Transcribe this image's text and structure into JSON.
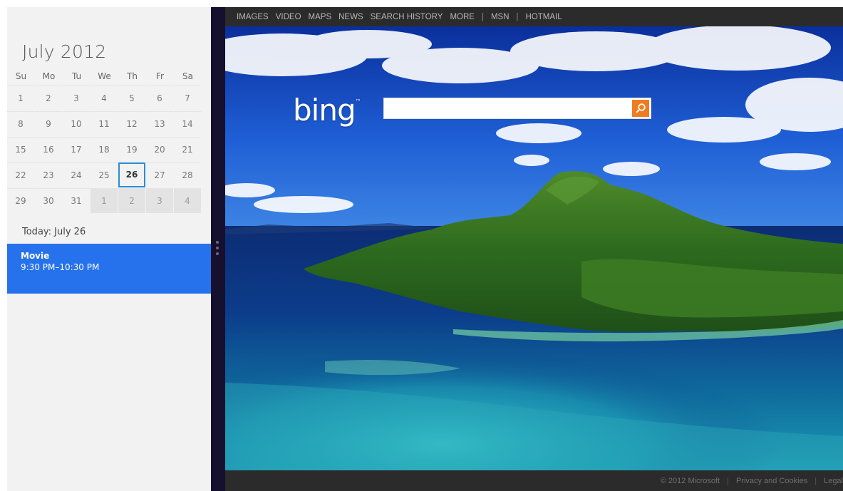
{
  "calendar": {
    "month_title": "July 2012",
    "weekdays": [
      "Su",
      "Mo",
      "Tu",
      "We",
      "Th",
      "Fr",
      "Sa"
    ],
    "weeks": [
      [
        {
          "d": "1",
          "other": false
        },
        {
          "d": "2",
          "other": false
        },
        {
          "d": "3",
          "other": false
        },
        {
          "d": "4",
          "other": false
        },
        {
          "d": "5",
          "other": false
        },
        {
          "d": "6",
          "other": false
        },
        {
          "d": "7",
          "other": false
        }
      ],
      [
        {
          "d": "8",
          "other": false
        },
        {
          "d": "9",
          "other": false
        },
        {
          "d": "10",
          "other": false
        },
        {
          "d": "11",
          "other": false
        },
        {
          "d": "12",
          "other": false
        },
        {
          "d": "13",
          "other": false
        },
        {
          "d": "14",
          "other": false
        }
      ],
      [
        {
          "d": "15",
          "other": false
        },
        {
          "d": "16",
          "other": false
        },
        {
          "d": "17",
          "other": false
        },
        {
          "d": "18",
          "other": false
        },
        {
          "d": "19",
          "other": false
        },
        {
          "d": "20",
          "other": false
        },
        {
          "d": "21",
          "other": false
        }
      ],
      [
        {
          "d": "22",
          "other": false
        },
        {
          "d": "23",
          "other": false
        },
        {
          "d": "24",
          "other": false
        },
        {
          "d": "25",
          "other": false
        },
        {
          "d": "26",
          "other": false,
          "today": true
        },
        {
          "d": "27",
          "other": false
        },
        {
          "d": "28",
          "other": false
        }
      ],
      [
        {
          "d": "29",
          "other": false
        },
        {
          "d": "30",
          "other": false
        },
        {
          "d": "31",
          "other": false
        },
        {
          "d": "1",
          "other": true
        },
        {
          "d": "2",
          "other": true
        },
        {
          "d": "3",
          "other": true
        },
        {
          "d": "4",
          "other": true
        }
      ]
    ],
    "today_label": "Today: July 26",
    "event": {
      "title": "Movie",
      "time": "9:30 PM–10:30 PM"
    }
  },
  "browser": {
    "nav_links": [
      "IMAGES",
      "VIDEO",
      "MAPS",
      "NEWS",
      "SEARCH HISTORY",
      "MORE"
    ],
    "nav_separator": "|",
    "nav_extra": [
      "MSN",
      "HOTMAIL"
    ],
    "logo_text": "bing",
    "logo_tm": "™",
    "search_value": "",
    "footer": [
      "© 2012 Microsoft",
      "Privacy and Cookies",
      "Legal"
    ],
    "footer_separator": "|"
  },
  "colors": {
    "calendar_bg": "#f2f2f2",
    "event_blue": "#2672ec",
    "today_border": "#2a8dd4",
    "splitter": "#15102e",
    "bing_bar": "#2b2b2b",
    "search_button": "#f07c1f"
  },
  "icons": {
    "search_button": "magnifier-icon",
    "splitter_grip": "grip-dots-icon"
  }
}
